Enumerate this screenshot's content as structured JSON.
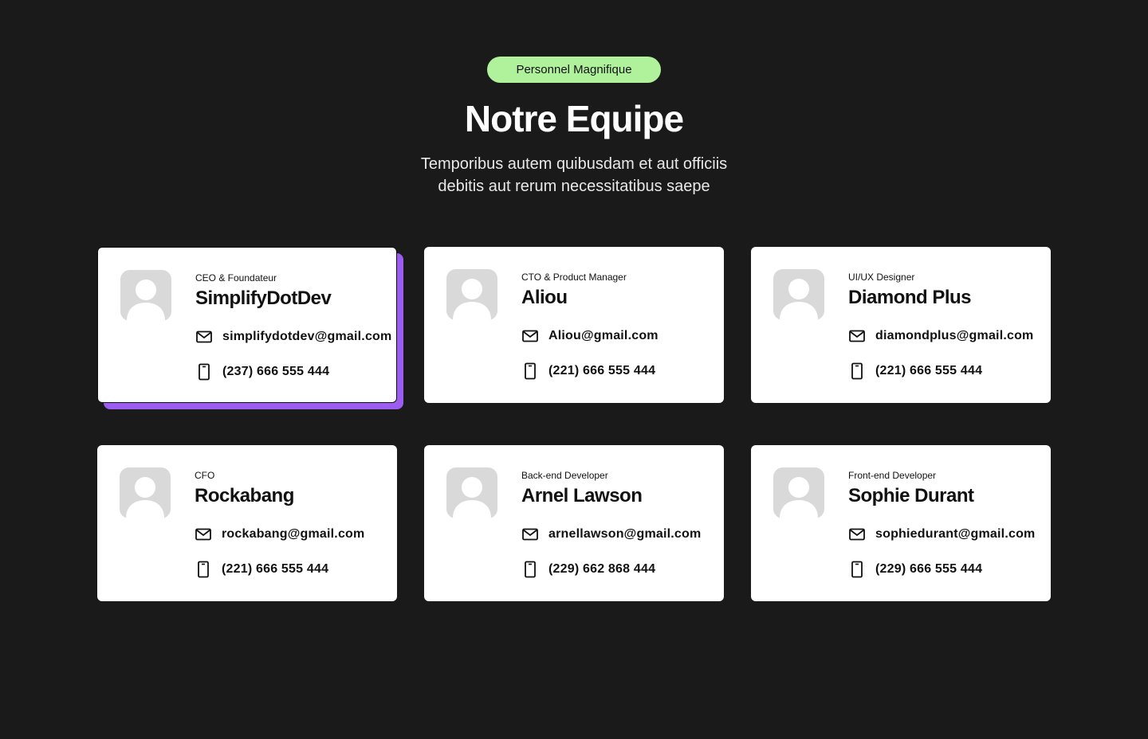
{
  "header": {
    "badge": "Personnel Magnifique",
    "title": "Notre Equipe",
    "subtitle_line1": "Temporibus autem quibusdam et aut officiis",
    "subtitle_line2": "debitis aut rerum necessitatibus saepe"
  },
  "colors": {
    "background": "#1a1a1a",
    "badge": "#b0f29c",
    "card": "#ffffff",
    "active_shadow": "#9b5cf0",
    "avatar_bg": "#d9d9d9",
    "avatar_fg": "#ffffff"
  },
  "icons": {
    "avatar": "user-icon",
    "email": "mail-icon",
    "phone": "phone-icon"
  },
  "team": [
    {
      "role": "CEO & Foundateur",
      "name": "SimplifyDotDev",
      "email": "simplifydotdev@gmail.com",
      "phone": "(237) 666 555 444",
      "active": true
    },
    {
      "role": "CTO & Product Manager",
      "name": "Aliou",
      "email": "Aliou@gmail.com",
      "phone": "(221) 666 555 444",
      "active": false
    },
    {
      "role": "UI/UX Designer",
      "name": "Diamond Plus",
      "email": "diamondplus@gmail.com",
      "phone": "(221) 666 555 444",
      "active": false
    },
    {
      "role": "CFO",
      "name": "Rockabang",
      "email": "rockabang@gmail.com",
      "phone": "(221) 666 555 444",
      "active": false
    },
    {
      "role": "Back-end Developer",
      "name": "Arnel Lawson",
      "email": "arnellawson@gmail.com",
      "phone": "(229) 662 868 444",
      "active": false
    },
    {
      "role": "Front-end Developer",
      "name": "Sophie Durant",
      "email": "sophiedurant@gmail.com",
      "phone": "(229) 666 555 444",
      "active": false
    }
  ]
}
